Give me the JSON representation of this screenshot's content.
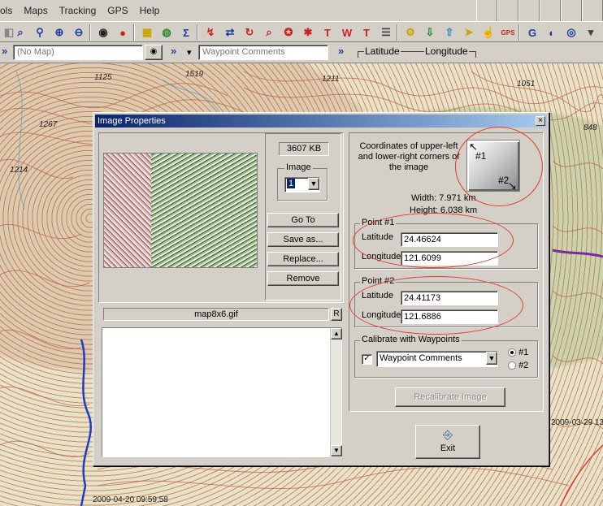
{
  "menubar": {
    "items": [
      "ols",
      "Maps",
      "Tracking",
      "GPS",
      "Help"
    ]
  },
  "bar2": {
    "map_combo_value": "(No Map)",
    "waypoint_combo_value": "Waypoint Comments",
    "latitude_label": "Latitude",
    "longitude_label": "Longitude"
  },
  "map": {
    "labels": [
      "1125",
      "1519",
      "1211",
      "1051",
      "1267",
      "848",
      "1214"
    ],
    "timestamps": [
      "2009-04-20 09:59:58",
      "2009-03-29 13"
    ]
  },
  "dialog": {
    "title": "Image Properties",
    "size_label": "3607 KB",
    "image_group_label": "Image",
    "image_select_value": "1",
    "buttons": {
      "goto": "Go To",
      "save_as": "Save as...",
      "replace": "Replace...",
      "remove": "Remove",
      "recalibrate": "Recalibrate Image",
      "exit": "Exit"
    },
    "filename": "map8x6.gif",
    "filename_button": "R",
    "coords_desc": "Coordinates of upper-left and lower-right corners of the image",
    "corner_markers": [
      "#1",
      "#2"
    ],
    "width_text": "Width: 7.971 km",
    "height_text": "Height: 6.038 km",
    "point1": {
      "title": "Point #1",
      "lat_label": "Latitude",
      "lat": "24.46624",
      "lon_label": "Longitude",
      "lon": "121.6099"
    },
    "point2": {
      "title": "Point #2",
      "lat_label": "Latitude",
      "lat": "24.41173",
      "lon_label": "Longitude",
      "lon": "121.6886"
    },
    "calibrate": {
      "title": "Calibrate with Waypoints",
      "combo_value": "Waypoint Comments",
      "checked": true,
      "radio1": "#1",
      "radio2": "#2",
      "selected_radio": "#1"
    }
  },
  "colors": {
    "title_start": "#0a246a",
    "title_end": "#a6caf0",
    "annotation": "#e03a2a"
  }
}
